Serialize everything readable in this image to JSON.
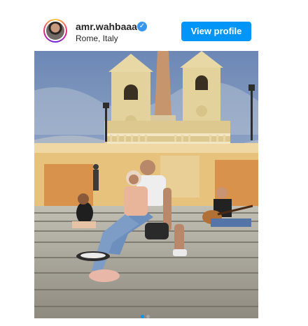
{
  "post": {
    "username": "amr.wahbaaa",
    "location": "Rome, Italy",
    "view_profile_label": "View profile"
  },
  "carousel": {
    "current_slide": 1,
    "total_slides": 2
  },
  "colors": {
    "accent": "#0095f6",
    "verified": "#3897f0",
    "text": "#262626"
  },
  "icons": {
    "verified": "verified-badge-icon",
    "next": "chevron-right-icon"
  }
}
